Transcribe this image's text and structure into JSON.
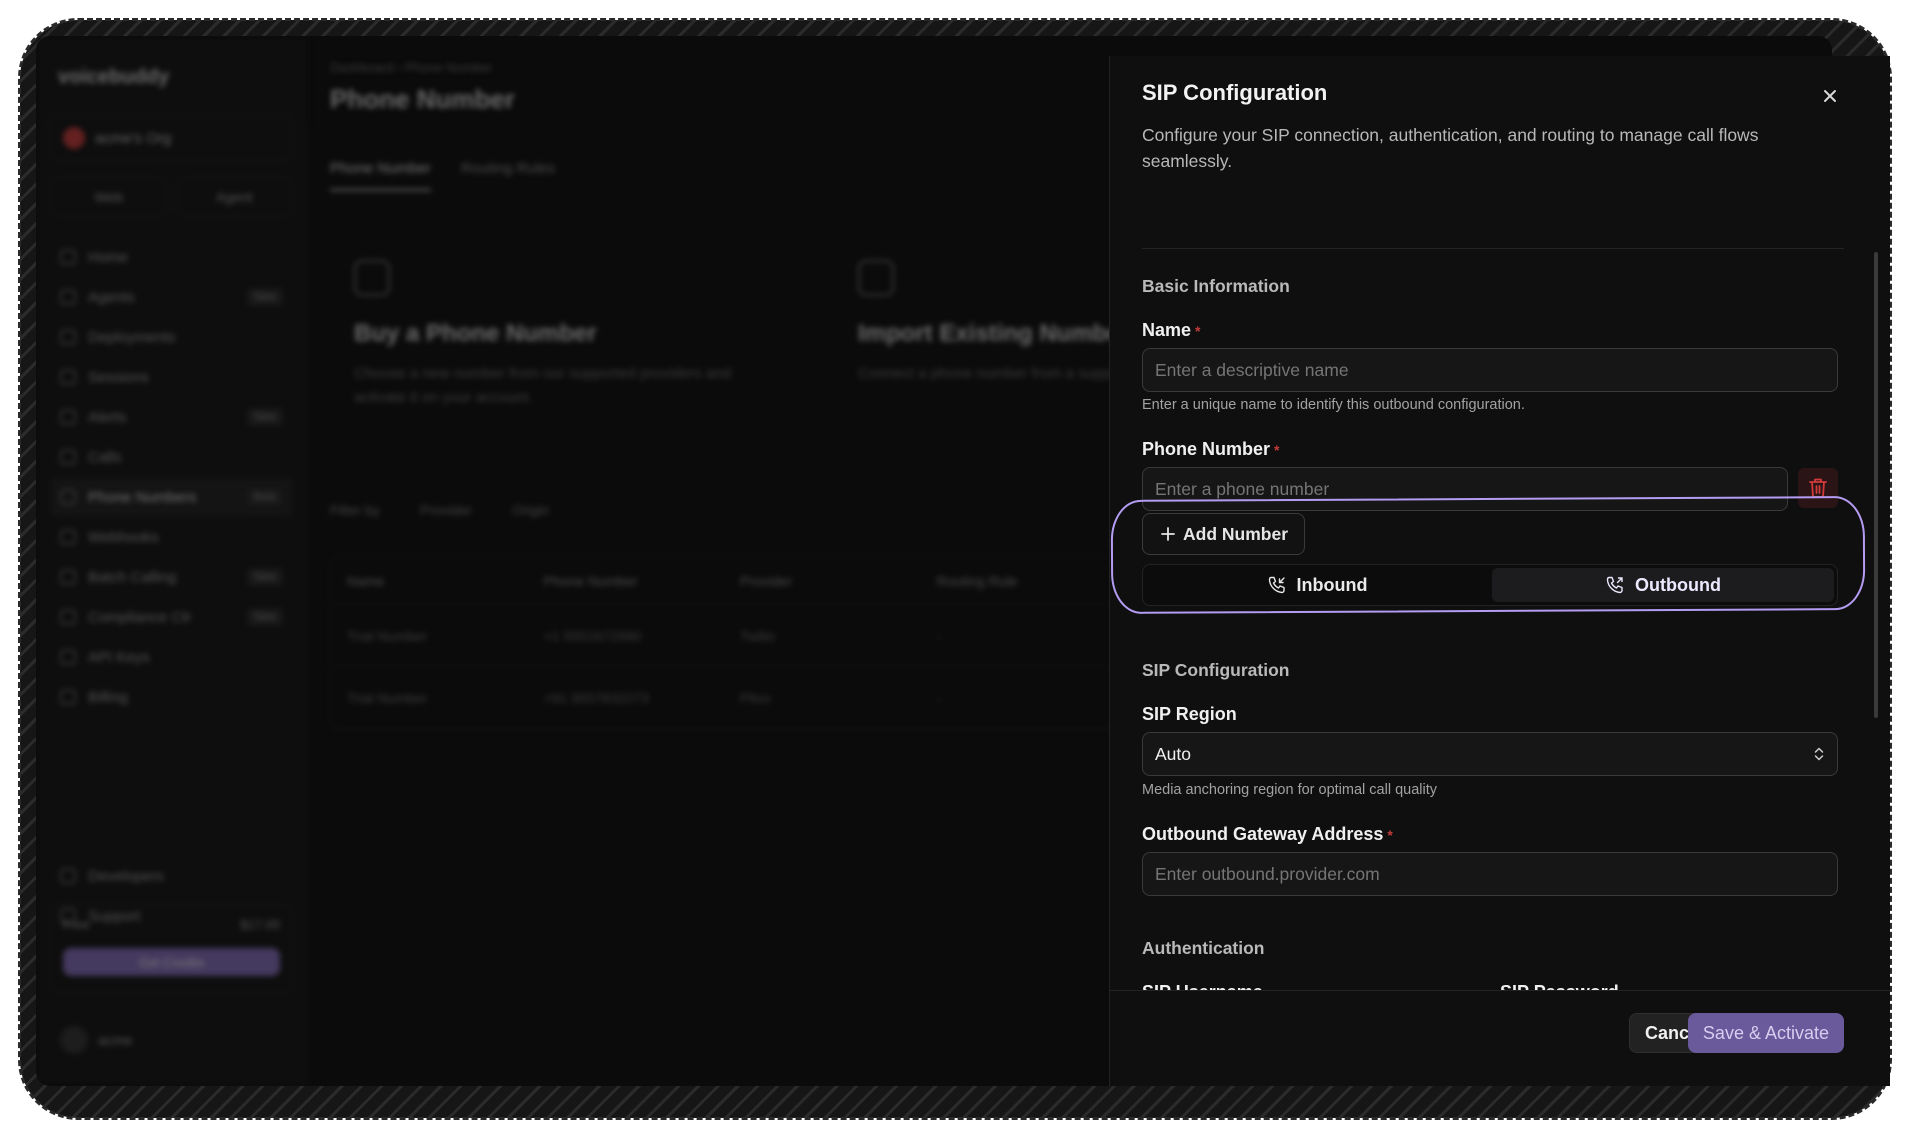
{
  "background_app": {
    "brand": "voicebuddy",
    "org_name": "acme's Org",
    "seg_left": "Web",
    "seg_right": "Agent",
    "nav": [
      {
        "label": "Home",
        "badge": ""
      },
      {
        "label": "Agents",
        "badge": "New"
      },
      {
        "label": "Deployments",
        "badge": ""
      },
      {
        "label": "Sessions",
        "badge": ""
      },
      {
        "label": "Alerts",
        "badge": "New"
      },
      {
        "label": "Calls",
        "badge": ""
      },
      {
        "label": "Phone Numbers",
        "badge": "Beta"
      },
      {
        "label": "Webhooks",
        "badge": ""
      },
      {
        "label": "Batch Calling",
        "badge": "New"
      },
      {
        "label": "Compliance Ctr",
        "badge": "New"
      },
      {
        "label": "API Keys",
        "badge": ""
      },
      {
        "label": "Billing",
        "badge": ""
      }
    ],
    "nav_bottom": [
      {
        "label": "Developers"
      },
      {
        "label": "Support"
      }
    ],
    "credits_label": "Free",
    "credits_value": "$17.00",
    "credits_button": "Get Credits",
    "user_name": "acme",
    "breadcrumb": "Dashboard  ›  Phone Number",
    "page_title": "Phone Number",
    "tabs": [
      "Phone Number",
      "Routing Rules"
    ],
    "cards": [
      {
        "title": "Buy a Phone Number",
        "desc": "Choose a new number from our supported providers and activate it on your account."
      },
      {
        "title": "Import Existing Number",
        "desc": "Connect a phone number from a supported provider."
      }
    ],
    "filters": [
      "Filter by",
      "Provider",
      "Origin"
    ],
    "table_headers": [
      "Name",
      "Phone Number",
      "Provider",
      "Routing Rule"
    ],
    "table_rows": [
      [
        "Trial Number",
        "+1 5551672990",
        "Twilio",
        "-"
      ],
      [
        "Trial Number",
        "+91 9557832273",
        "Plivo",
        "-"
      ]
    ]
  },
  "drawer": {
    "title": "SIP Configuration",
    "description": "Configure your SIP connection, authentication, and routing to manage call flows seamlessly.",
    "basic_section": "Basic Information",
    "name_label": "Name",
    "name_placeholder": "Enter a descriptive name",
    "name_help": "Enter a unique name to identify this outbound configuration.",
    "phone_label": "Phone Number",
    "phone_placeholder": "Enter a phone number",
    "add_number": "Add Number",
    "direction_options": [
      "Inbound",
      "Outbound"
    ],
    "direction_selected": "Outbound",
    "sip_section": "SIP Configuration",
    "region_label": "SIP Region",
    "region_value": "Auto",
    "region_help": "Media anchoring region for optimal call quality",
    "gateway_label": "Outbound Gateway Address",
    "gateway_placeholder": "Enter outbound.provider.com",
    "auth_section": "Authentication",
    "username_label": "SIP Username",
    "password_label": "SIP Password",
    "cancel": "Cancel",
    "save": "Save & Activate"
  },
  "colors": {
    "accent": "#8a72c4",
    "highlight": "#b49cf2",
    "danger": "#c23b3b"
  }
}
